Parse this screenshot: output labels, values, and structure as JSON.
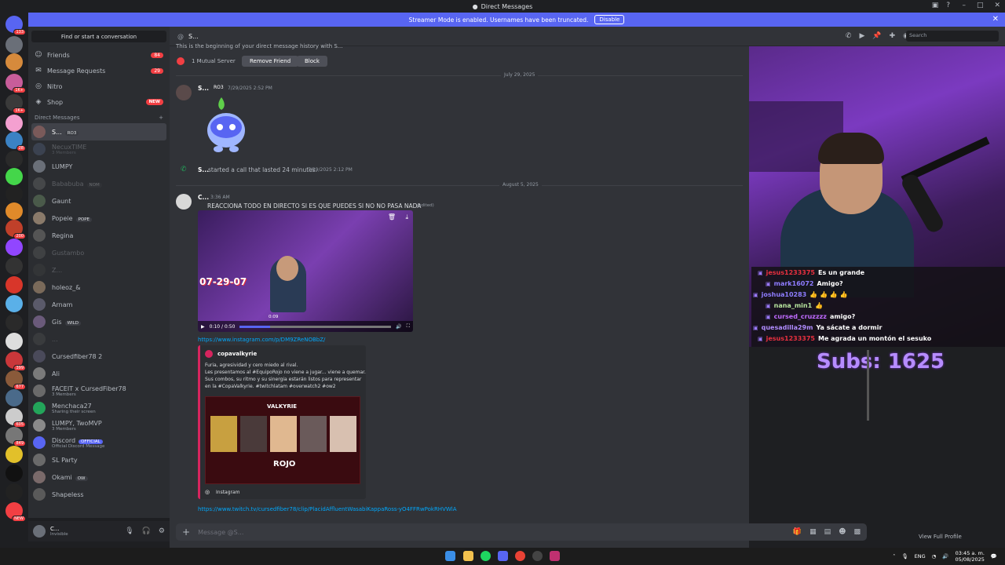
{
  "window": {
    "title": "Direct Messages"
  },
  "banner": {
    "text": "Streamer Mode is enabled. Usernames have been truncated.",
    "button": "Disable"
  },
  "rail_badges": [
    "133",
    "1K+",
    "1K+",
    "28",
    "200",
    "677",
    "605",
    "849",
    "399",
    "NEW"
  ],
  "sidebar": {
    "find": "Find or start a conversation",
    "nav": [
      {
        "label": "Friends",
        "count": "84"
      },
      {
        "label": "Message Requests",
        "count": "29"
      },
      {
        "label": "Nitro",
        "count": ""
      },
      {
        "label": "Shop",
        "badge": "NEW"
      }
    ],
    "dm_header": "Direct Messages",
    "dm_add": "+",
    "dms": [
      {
        "name": "S...",
        "tag": "RO3",
        "active": true
      },
      {
        "name": "NecuxTIME",
        "sub": "3 Members",
        "faded": true
      },
      {
        "name": "LUMPY"
      },
      {
        "name": "Bababuba",
        "tag": "NOM",
        "faded": true
      },
      {
        "name": "Gaunt"
      },
      {
        "name": "Popeie",
        "tag": "POPE"
      },
      {
        "name": "Regina"
      },
      {
        "name": "Gustambo",
        "faded": true
      },
      {
        "name": "Z...",
        "faded": true
      },
      {
        "name": "holeoz_&"
      },
      {
        "name": "Arnam"
      },
      {
        "name": "Gis",
        "tag": "WILD"
      },
      {
        "name": "...",
        "faded": true
      },
      {
        "name": "Cursedfiber78 2"
      },
      {
        "name": "Ali"
      },
      {
        "name": "FACEIT x CursedFiber78",
        "sub": "3 Members"
      },
      {
        "name": "Menchaca27",
        "sub": "Sharing their screen"
      },
      {
        "name": "LUMPY, TwoMVP",
        "sub": "3 Members"
      },
      {
        "name": "Discord",
        "tag": "OFFICIAL",
        "sub": "Official Discord Message",
        "official": true
      },
      {
        "name": "SL Party"
      },
      {
        "name": "Okami",
        "tag": "OW"
      },
      {
        "name": "Shapeless"
      }
    ]
  },
  "user": {
    "name": "C...",
    "status": "Invisible"
  },
  "header": {
    "name": "S...",
    "search": "Search"
  },
  "main": {
    "intro": "This is the beginning of your direct message history with S...",
    "mutual": "1 Mutual Server",
    "remove_friend": "Remove Friend",
    "block": "Block",
    "date1": "July 29, 2025",
    "msg1_author": "S...",
    "msg1_tag": "RO3",
    "msg1_time": "7/29/2025 2:52 PM",
    "call_author": "S...",
    "call_text": "started a call that lasted 24 minutes.",
    "call_time": "7/29/2025 2:12 PM",
    "date2": "August 5, 2025",
    "msg2_author": "C...",
    "msg2_time": "3:36 AM",
    "msg2_text": "REACCIONA TODO EN DIRECTO SI ES QUE PUEDES SI NO NO PASA NADA",
    "msg2_edited": "(edited)",
    "video_time": "0:10 / 0:50",
    "video_overlay": "07-29-07",
    "video_scrub": "0:09",
    "link1": "https://www.instagram.com/p/DM9ZReNOBbZ/",
    "embed_author": "copavalkyrie",
    "embed_text1": "Furia, agresividad y cero miedo al rival.",
    "embed_text2": "Les presentamos al #EquipoRojo no viene a jugar... viene a quemar.",
    "embed_text3": "Sus combos, su ritmo y su sinergia estarán listos para representar",
    "embed_text4": "en la #CopaValkyrie. #twitchlatam #overwatch2 #ow2",
    "embed_footer": "Instagram",
    "embed_banner_title": "VALKYRIE",
    "embed_banner_team": "ROJO",
    "link2": "https://www.twitch.tv/cursedfiber78/clip/PlacidAffluentWasabiKappaRoss-yO4FFRwPokRHVWlA",
    "composer": "Message @S...",
    "view_full_profile": "View Full Profile"
  },
  "chat": [
    {
      "user": "jesus1233375",
      "color": "#e8303f",
      "msg": "Es un grande"
    },
    {
      "user": "mark16072",
      "color": "#8f7cff",
      "msg": "Amigo?"
    },
    {
      "user": "joshua10283",
      "color": "#8f7cff",
      "msg": "👍 👍 👍 👍"
    },
    {
      "user": "nana_min1",
      "color": "#b6e39d",
      "msg": "👍"
    },
    {
      "user": "cursed_cruzzzz",
      "color": "#c06bff",
      "msg": "amigo?"
    },
    {
      "user": "quesadilla29m",
      "color": "#b08cff",
      "msg": "Ya sácate a dormir"
    },
    {
      "user": "jesus1233375",
      "color": "#e8303f",
      "msg": "Me agrada un montón el sesuko"
    }
  ],
  "subs": "Subs: 1625",
  "taskbar": {
    "lang": "ENG",
    "time": "03:45 a. m.",
    "date": "05/08/2025"
  }
}
